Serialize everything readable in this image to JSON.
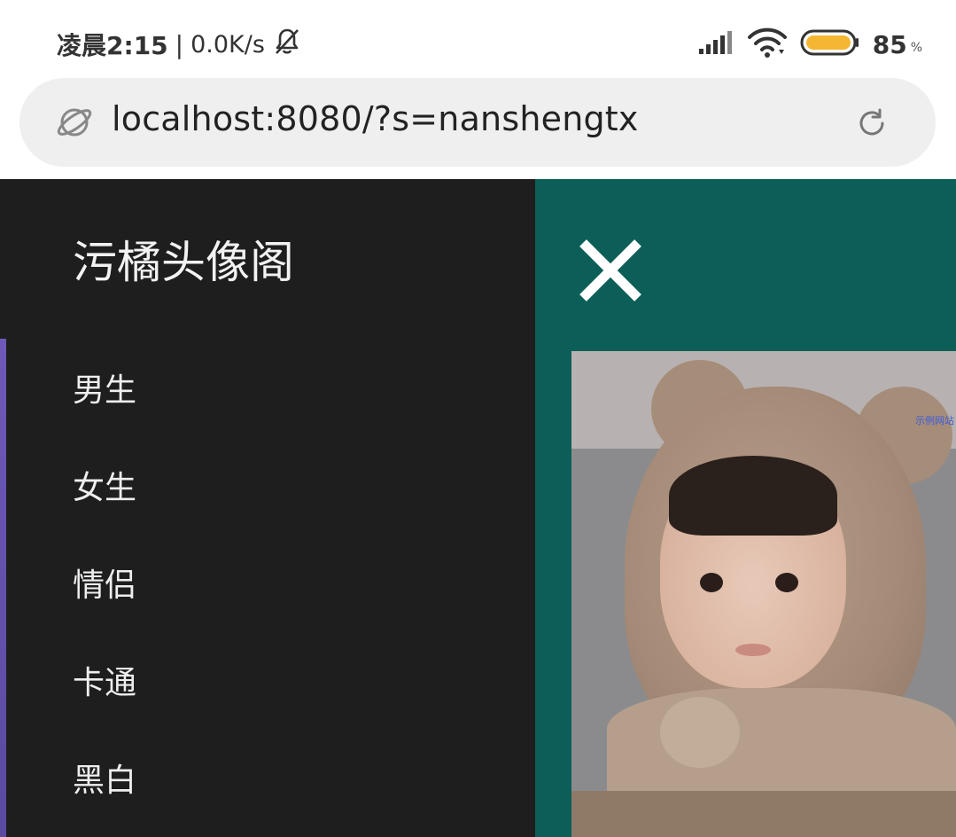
{
  "status_bar": {
    "time_prefix": "凌晨",
    "time": "2:15",
    "separator": "|",
    "net_speed": "0.0K/s",
    "battery_level": "85",
    "battery_unit": "%",
    "battery_color": "#f5b731",
    "icons": [
      "mute-bell-icon",
      "signal-icon",
      "wifi-icon",
      "battery-icon"
    ]
  },
  "url_bar": {
    "url": "localhost:8080/?s=nanshengtx",
    "icons": [
      "globe-icon",
      "reload-icon"
    ]
  },
  "drawer": {
    "title": "污橘头像阁",
    "items": [
      {
        "label": "男生"
      },
      {
        "label": "女生"
      },
      {
        "label": "情侣"
      },
      {
        "label": "卡通"
      },
      {
        "label": "黑白"
      }
    ]
  },
  "main": {
    "background_color": "#0c5f58",
    "close_icon": "close-icon",
    "image_caption": "示例网站"
  }
}
